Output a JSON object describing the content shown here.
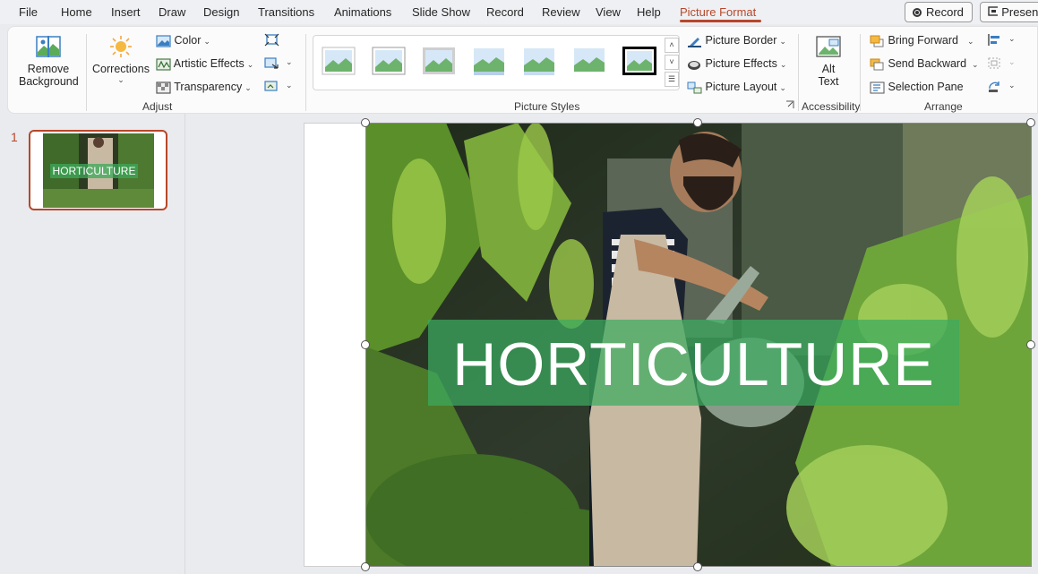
{
  "menu": {
    "tabs": [
      "File",
      "Home",
      "Insert",
      "Draw",
      "Design",
      "Transitions",
      "Animations",
      "Slide Show",
      "Record",
      "Review",
      "View",
      "Help",
      "Picture Format"
    ],
    "active_tab": "Picture Format",
    "record_label": "Record",
    "present_label": "Present"
  },
  "ribbon": {
    "remove_background": [
      "Remove",
      "Background"
    ],
    "corrections": "Corrections",
    "color": "Color",
    "artistic_effects": "Artistic Effects",
    "transparency": "Transparency",
    "adjust_label": "Adjust",
    "picture_styles_label": "Picture Styles",
    "picture_border": "Picture Border",
    "picture_effects": "Picture Effects",
    "picture_layout": "Picture Layout",
    "alt_text": [
      "Alt",
      "Text"
    ],
    "accessibility_label": "Accessibility",
    "bring_forward": "Bring Forward",
    "send_backward": "Send Backward",
    "selection_pane": "Selection Pane",
    "arrange_label": "Arrange"
  },
  "slides": {
    "number": "1",
    "thumb_title": "HORTICULTURE"
  },
  "slide": {
    "title": "HORTICULTURE"
  },
  "colors": {
    "accent": "#b7472a",
    "title_band": "#3caa5f"
  }
}
